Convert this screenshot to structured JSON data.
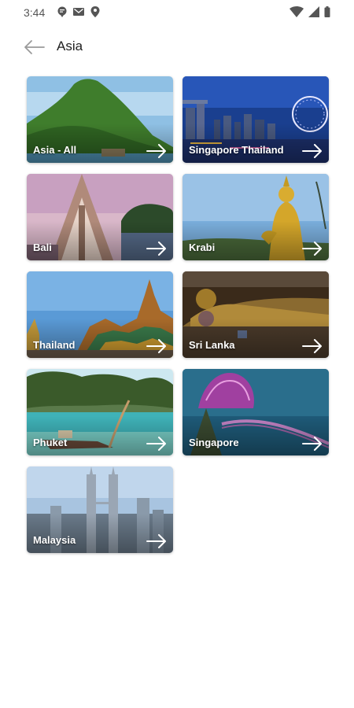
{
  "status_bar": {
    "time": "3:44",
    "icons": [
      "message-icon",
      "gmail-icon",
      "location-icon",
      "wifi-icon",
      "signal-icon",
      "battery-icon"
    ]
  },
  "header": {
    "title": "Asia",
    "back_icon": "arrow-left-icon"
  },
  "destinations": [
    {
      "label": "Asia - All",
      "scene": "tropical island with hill"
    },
    {
      "label": "Singapore Thailand",
      "scene": "city skyline at night with ferris wheel"
    },
    {
      "label": "Bali",
      "scene": "triangular chapel at sunset"
    },
    {
      "label": "Krabi",
      "scene": "golden buddha statue"
    },
    {
      "label": "Thailand",
      "scene": "temple rooftops"
    },
    {
      "label": "Sri Lanka",
      "scene": "reclining buddha"
    },
    {
      "label": "Phuket",
      "scene": "longtail boat in bay"
    },
    {
      "label": "Singapore",
      "scene": "supertree grove"
    },
    {
      "label": "Malaysia",
      "scene": "petronas towers"
    }
  ],
  "colors": {
    "accent": "#ffffff",
    "title": "#1f1f1f",
    "status": "#555555"
  }
}
